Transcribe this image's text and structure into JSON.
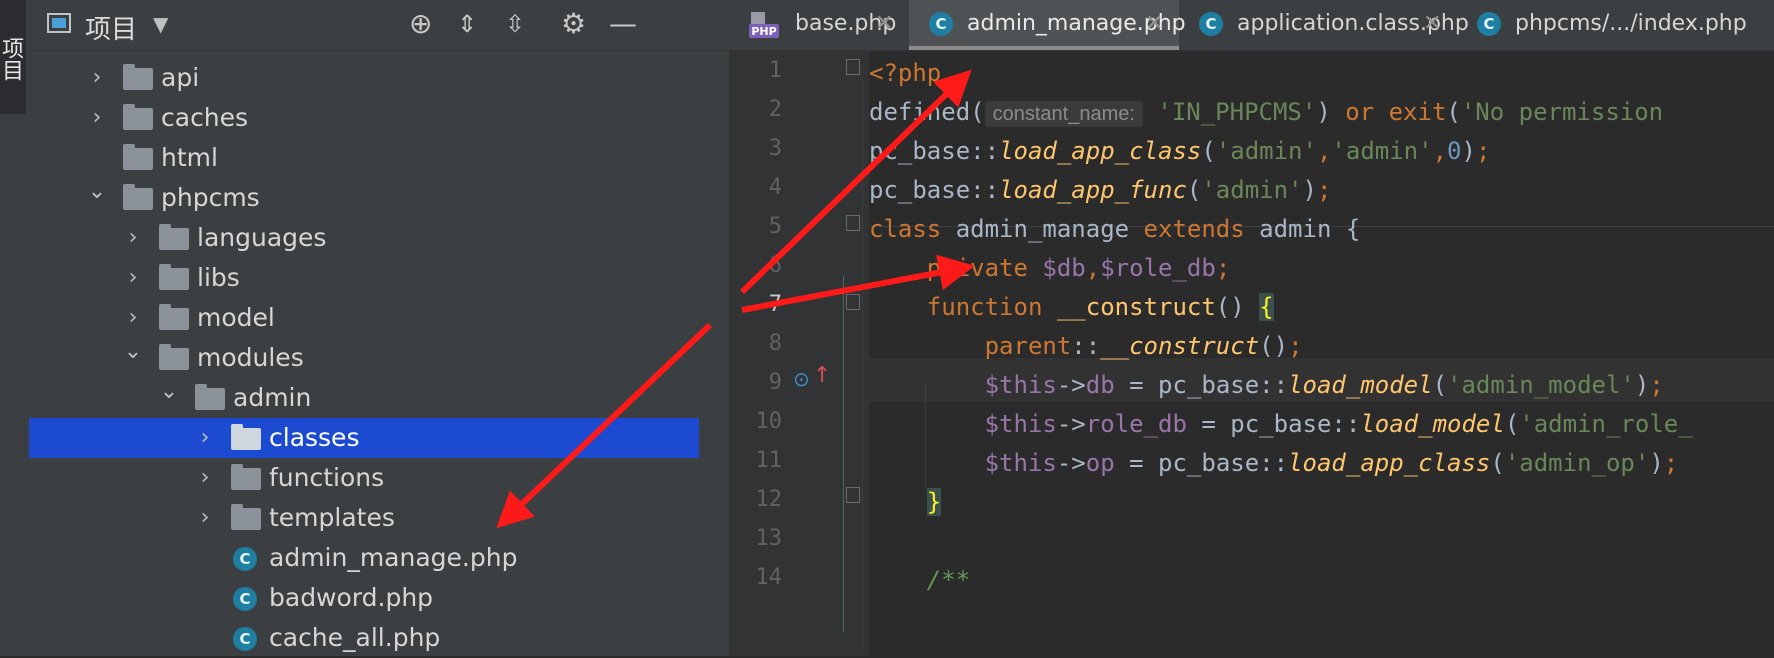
{
  "sidebar_strip": {
    "label": "项目"
  },
  "project": {
    "title": "项目",
    "tree": [
      {
        "label": "api",
        "kind": "folder",
        "expanded": false,
        "depth": 1
      },
      {
        "label": "caches",
        "kind": "folder",
        "expanded": false,
        "depth": 1
      },
      {
        "label": "html",
        "kind": "folder",
        "expanded": null,
        "depth": 1
      },
      {
        "label": "phpcms",
        "kind": "folder",
        "expanded": true,
        "depth": 1
      },
      {
        "label": "languages",
        "kind": "folder",
        "expanded": false,
        "depth": 2
      },
      {
        "label": "libs",
        "kind": "folder",
        "expanded": false,
        "depth": 2
      },
      {
        "label": "model",
        "kind": "folder",
        "expanded": false,
        "depth": 2
      },
      {
        "label": "modules",
        "kind": "folder",
        "expanded": true,
        "depth": 2
      },
      {
        "label": "admin",
        "kind": "folder",
        "expanded": true,
        "depth": 3
      },
      {
        "label": "classes",
        "kind": "folder",
        "expanded": false,
        "depth": 4,
        "selected": true
      },
      {
        "label": "functions",
        "kind": "folder",
        "expanded": false,
        "depth": 4
      },
      {
        "label": "templates",
        "kind": "folder",
        "expanded": false,
        "depth": 4
      },
      {
        "label": "admin_manage.php",
        "kind": "php-class",
        "depth": 4
      },
      {
        "label": "badword.php",
        "kind": "php-class",
        "depth": 4
      },
      {
        "label": "cache_all.php",
        "kind": "php-class",
        "depth": 4
      }
    ]
  },
  "tabs": [
    {
      "label": "base.php",
      "icon": "php-file-icon",
      "active": false
    },
    {
      "label": "admin_manage.php",
      "icon": "php-class-icon",
      "active": true
    },
    {
      "label": "application.class.php",
      "icon": "php-class-icon",
      "active": false
    },
    {
      "label": "phpcms/.../index.php",
      "icon": "php-class-icon",
      "active": false
    }
  ],
  "editor": {
    "current_line": 7,
    "line_numbers": [
      "1",
      "2",
      "3",
      "4",
      "5",
      "6",
      "7",
      "8",
      "9",
      "10",
      "11",
      "12",
      "13",
      "14"
    ],
    "parameter_hint": "constant_name:",
    "tokens": {
      "php_open": "<?php",
      "defined": "defined(",
      "in_phpcms": "'IN_PHPCMS'",
      "or_kw": "or",
      "exit_kw": "exit",
      "no_perm": "'No permission",
      "pc_base": "pc_base",
      "dcolon": "::",
      "load_app_class": "load_app_class",
      "load_app_func": "load_app_func",
      "load_model": "load_model",
      "s_admin": "'admin'",
      "comma": ",",
      "zero": "0",
      "class_kw": "class",
      "class_name": "admin_manage",
      "extends_kw": "extends",
      "parent_cls": "admin",
      "private_kw": "private",
      "db_var": "$db",
      "role_db_var": "$role_db",
      "function_kw": "function",
      "construct": "__construct",
      "parent_kw": "parent",
      "this_var": "$this",
      "arrow": "->",
      "db_prop": "db",
      "role_db_prop": "role_db",
      "op_prop": "op",
      "eq": "=",
      "s_admin_model": "'admin_model'",
      "s_admin_role": "'admin_role_",
      "s_admin_op": "'admin_op'",
      "doc_open": "/**"
    }
  },
  "colors": {
    "accent_selection": "#1c4bd2",
    "annotation_arrow": "#ff1a1a"
  }
}
